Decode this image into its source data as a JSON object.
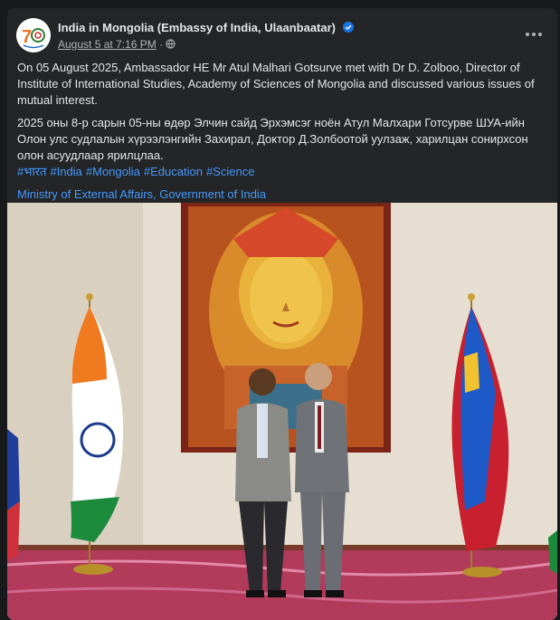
{
  "post": {
    "page_name": "India in Mongolia (Embassy of India, Ulaanbaatar)",
    "timestamp": "August 5 at 7:16 PM",
    "separator": "·",
    "icons": {
      "verified": "verified-badge-icon",
      "audience": "globe-icon",
      "more": "more-options-icon"
    },
    "text_en": "On 05 August 2025, Ambassador HE Mr Atul Malhari Gotsurve met with Dr D. Zolboo, Director of Institute of International Studies, Academy of Sciences of Mongolia and discussed various issues of mutual interest.",
    "text_mn": "2025 оны 8-р сарын 05-ны өдөр Элчин сайд Эрхэмсэг ноён Атул Малхари Готсурве ШУА-ийн Олон улс судлалын хүрээлэнгийн Захирал, Доктор Д.Золбоотой уулзаж, харилцан сонирхсон олон асуудлаар ярилцлаа.",
    "hashtags": [
      "#भारत",
      "#India",
      "#Mongolia",
      "#Education",
      "#Science"
    ],
    "mention": "Ministry of External Affairs, Government of India",
    "colors": {
      "link": "#4599ff",
      "card": "#242526",
      "verified": "#1b74e4"
    }
  }
}
